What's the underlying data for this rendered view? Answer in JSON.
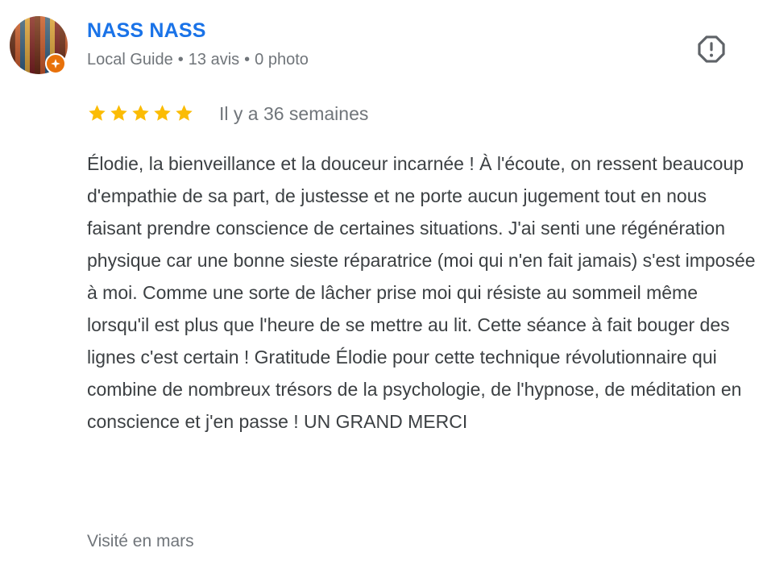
{
  "reviewer": {
    "name": "NASS NASS",
    "role": "Local Guide",
    "review_count": "13 avis",
    "photo_count": "0 photo",
    "separator": "•"
  },
  "review": {
    "rating": 5,
    "max_rating": 5,
    "date": "Il y a 36 semaines",
    "text": "Élodie, la bienveillance et la douceur incarnée ! À l'écoute, on ressent beaucoup d'empathie de sa part, de justesse et ne porte aucun jugement tout en nous faisant prendre conscience de certaines situations. J'ai senti une régénération physique car une bonne sieste réparatrice (moi qui n'en fait jamais) s'est imposée à moi. Comme une sorte de lâcher prise moi qui résiste au sommeil même lorsqu'il est plus que l'heure de se mettre au lit. Cette séance à fait bouger des lignes c'est certain ! Gratitude Élodie pour cette technique révolutionnaire qui combine de nombreux trésors de la psychologie, de l'hypnose, de méditation en conscience et j'en passe ! UN GRAND MERCI",
    "visit": "Visité en mars"
  },
  "icons": {
    "report": "report-flag-icon",
    "badge": "local-guide-star-icon",
    "star": "star-icon"
  },
  "colors": {
    "name_link": "#1a73e8",
    "star": "#fbbc04",
    "badge": "#e8710a",
    "muted_text": "#70757a",
    "body_text": "#3c4043"
  }
}
